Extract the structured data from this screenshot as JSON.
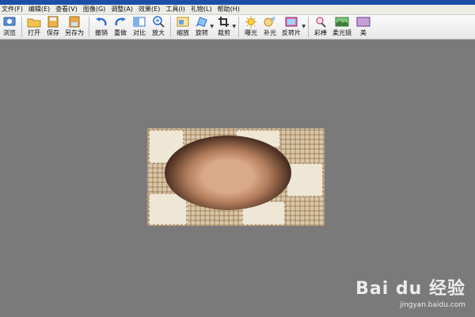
{
  "menu": [
    "文件(F)",
    "编辑(E)",
    "查看(V)",
    "图像(G)",
    "调整(A)",
    "效果(E)",
    "工具(I)",
    "礼物(L)",
    "帮助(H)"
  ],
  "toolbar": [
    {
      "label": "浏览",
      "icon": "browse-icon"
    },
    {
      "label": "打开",
      "icon": "folder-open-icon"
    },
    {
      "label": "保存",
      "icon": "save-icon"
    },
    {
      "label": "另存为",
      "icon": "save-as-icon"
    },
    {
      "label": "撤销",
      "icon": "undo-icon"
    },
    {
      "label": "重做",
      "icon": "redo-icon"
    },
    {
      "label": "对比",
      "icon": "compare-icon"
    },
    {
      "label": "放大",
      "icon": "zoom-in-icon"
    },
    {
      "label": "缩放",
      "icon": "resize-icon"
    },
    {
      "label": "旋转",
      "icon": "rotate-icon"
    },
    {
      "label": "裁剪",
      "icon": "crop-icon"
    },
    {
      "label": "曝光",
      "icon": "exposure-icon"
    },
    {
      "label": "补光",
      "icon": "fill-light-icon"
    },
    {
      "label": "反转片",
      "icon": "reversal-film-icon"
    },
    {
      "label": "彩棒",
      "icon": "color-wand-icon"
    },
    {
      "label": "柔光镜",
      "icon": "soft-light-icon"
    },
    {
      "label": "美",
      "icon": "beauty-icon"
    }
  ],
  "watermark": {
    "logo": "Bai du 经验",
    "url": "jingyan.baidu.com"
  }
}
